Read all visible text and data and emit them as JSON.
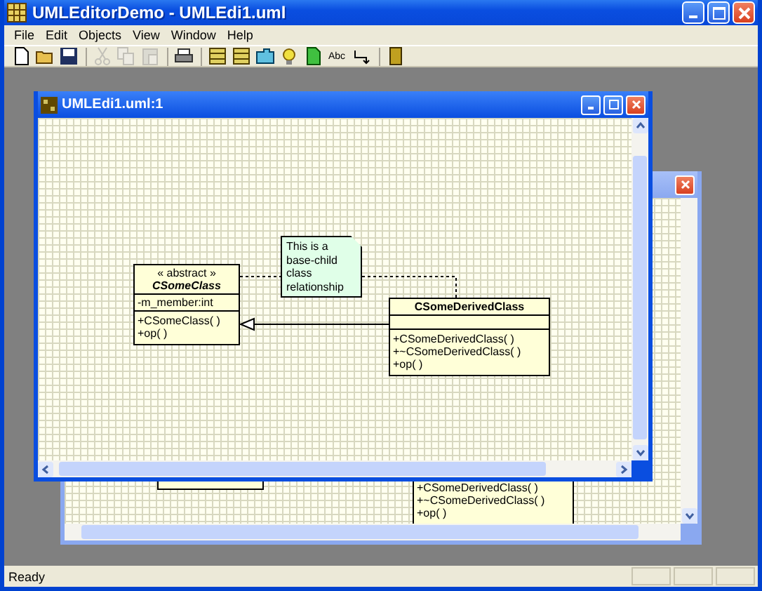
{
  "app": {
    "title": "UMLEditorDemo - UMLEdi1.uml"
  },
  "menu": [
    "File",
    "Edit",
    "Objects",
    "View",
    "Window",
    "Help"
  ],
  "toolbar": [
    {
      "kind": "new",
      "disabled": false
    },
    {
      "kind": "open",
      "disabled": false
    },
    {
      "kind": "save",
      "disabled": false
    },
    {
      "kind": "separator"
    },
    {
      "kind": "cut",
      "disabled": true
    },
    {
      "kind": "copy",
      "disabled": true
    },
    {
      "kind": "paste",
      "disabled": true
    },
    {
      "kind": "separator"
    },
    {
      "kind": "print",
      "disabled": false
    },
    {
      "kind": "separator"
    },
    {
      "kind": "class",
      "disabled": false
    },
    {
      "kind": "interface",
      "disabled": false
    },
    {
      "kind": "package",
      "disabled": false
    },
    {
      "kind": "note",
      "disabled": false
    },
    {
      "kind": "component",
      "disabled": false
    },
    {
      "kind": "label",
      "text": "Abc",
      "disabled": false
    },
    {
      "kind": "link",
      "disabled": false
    },
    {
      "kind": "separator"
    },
    {
      "kind": "book",
      "disabled": false
    }
  ],
  "back_window": {
    "active": false,
    "classes": [
      {
        "kind": "base"
      },
      {
        "kind": "derived",
        "operations": [
          "+CSomeDerivedClass( )",
          "+~CSomeDerivedClass( )",
          "+op( )"
        ]
      }
    ]
  },
  "front_window": {
    "title": "UMLEdi1.uml:1",
    "active": true,
    "classes": [
      {
        "stereotype": "« abstract »",
        "name": "CSomeClass",
        "abstract": true,
        "attributes": [
          "-m_member:int"
        ],
        "operations": [
          "+CSomeClass( )",
          "+op( )"
        ]
      },
      {
        "name": "CSomeDerivedClass",
        "abstract": false,
        "operations": [
          "+CSomeDerivedClass( )",
          "+~CSomeDerivedClass( )",
          "+op( )"
        ]
      }
    ],
    "note": {
      "text": "This is a\nbase-child\nclass\nrelationship"
    }
  },
  "status_bar": {
    "text": "Ready"
  }
}
